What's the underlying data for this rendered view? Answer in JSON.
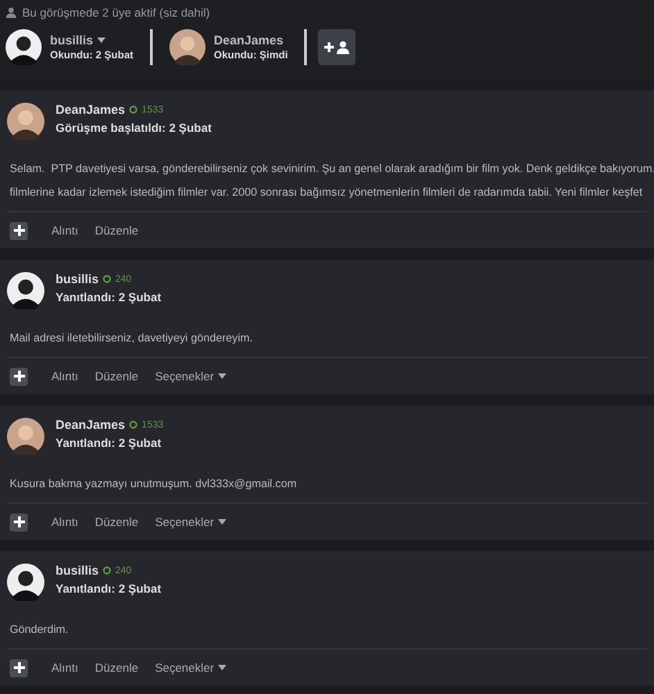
{
  "participants_note": "Bu görüşmede 2 üye aktif (siz dahil)",
  "participants": [
    {
      "name": "busillis",
      "read": "Okundu: 2 Şubat",
      "has_menu": true
    },
    {
      "name": "DeanJames",
      "read": "Okundu: Şimdi",
      "has_menu": false
    }
  ],
  "posts": [
    {
      "author": "DeanJames",
      "points": "1533",
      "date": "Görüşme başlatıldı: 2 Şubat",
      "body": [
        "Selam.  PTP davetiyesi varsa, gönderebilirseniz çok sevinirim. Şu an genel olarak aradığım bir film yok. Denk geldikçe bakıyorum.",
        "filmlerine kadar izlemek istediğim filmler var. 2000 sonrası bağımsız yönetmenlerin filmleri de radarımda tabii. Yeni filmler keşfet"
      ],
      "actions": [
        "Alıntı",
        "Düzenle"
      ]
    },
    {
      "author": "busillis",
      "points": "240",
      "date": "Yanıtlandı: 2 Şubat",
      "body": [
        "Mail adresi iletebilirseniz, davetiyeyi göndereyim."
      ],
      "actions": [
        "Alıntı",
        "Düzenle"
      ],
      "options": "Seçenekler"
    },
    {
      "author": "DeanJames",
      "points": "1533",
      "date": "Yanıtlandı: 2 Şubat",
      "body": [
        "Kusura bakma yazmayı unutmuşum. dvl333x@gmail.com"
      ],
      "actions": [
        "Alıntı",
        "Düzenle"
      ],
      "options": "Seçenekler"
    },
    {
      "author": "busillis",
      "points": "240",
      "date": "Yanıtlandı: 2 Şubat",
      "body": [
        "Gönderdim."
      ],
      "actions": [
        "Alıntı",
        "Düzenle"
      ],
      "options": "Seçenekler"
    }
  ]
}
